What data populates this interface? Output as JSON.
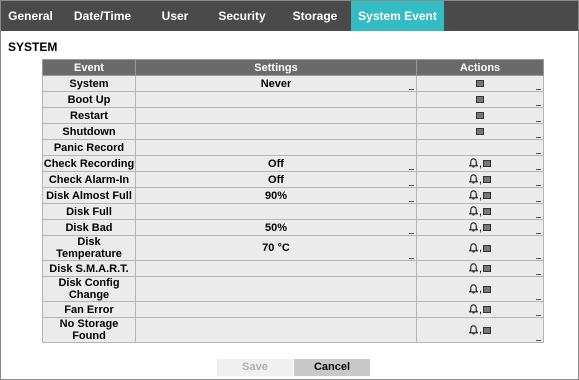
{
  "tabs": [
    {
      "label": "General"
    },
    {
      "label": "Date/Time"
    },
    {
      "label": "User"
    },
    {
      "label": "Security"
    },
    {
      "label": "Storage"
    },
    {
      "label": "System Event",
      "active": true
    }
  ],
  "section_title": "SYSTEM",
  "table": {
    "headers": {
      "event": "Event",
      "settings": "Settings",
      "actions": "Actions"
    },
    "rows": [
      {
        "event": "System",
        "settings": "Never",
        "actions": [
          "note-icon"
        ]
      },
      {
        "event": "Boot Up",
        "settings": "",
        "actions": [
          "note-icon"
        ]
      },
      {
        "event": "Restart",
        "settings": "",
        "actions": [
          "note-icon"
        ]
      },
      {
        "event": "Shutdown",
        "settings": "",
        "actions": [
          "note-icon"
        ]
      },
      {
        "event": "Panic Record",
        "settings": "",
        "actions": []
      },
      {
        "event": "Check Recording",
        "settings": "Off",
        "actions": [
          "bell-icon",
          "note-icon"
        ]
      },
      {
        "event": "Check Alarm-In",
        "settings": "Off",
        "actions": [
          "bell-icon",
          "note-icon"
        ]
      },
      {
        "event": "Disk Almost Full",
        "settings": "90%",
        "actions": [
          "bell-icon",
          "note-icon"
        ]
      },
      {
        "event": "Disk Full",
        "settings": "",
        "actions": [
          "bell-icon",
          "note-icon"
        ]
      },
      {
        "event": "Disk Bad",
        "settings": "50%",
        "actions": [
          "bell-icon",
          "note-icon"
        ]
      },
      {
        "event": "Disk Temperature",
        "settings": "70 °C",
        "actions": [
          "bell-icon",
          "note-icon"
        ]
      },
      {
        "event": "Disk S.M.A.R.T.",
        "settings": "",
        "actions": [
          "bell-icon",
          "note-icon"
        ]
      },
      {
        "event": "Disk Config Change",
        "settings": "",
        "actions": [
          "bell-icon",
          "note-icon"
        ]
      },
      {
        "event": "Fan Error",
        "settings": "",
        "actions": [
          "bell-icon",
          "note-icon"
        ]
      },
      {
        "event": "No Storage Found",
        "settings": "",
        "actions": [
          "bell-icon",
          "note-icon"
        ]
      }
    ]
  },
  "buttons": {
    "save": "Save",
    "cancel": "Cancel"
  },
  "colors": {
    "tab_bar": "#4a4a4a",
    "active_tab": "#33bcc4",
    "table_header": "#6a6a6a",
    "row_bg": "#ebebeb"
  }
}
